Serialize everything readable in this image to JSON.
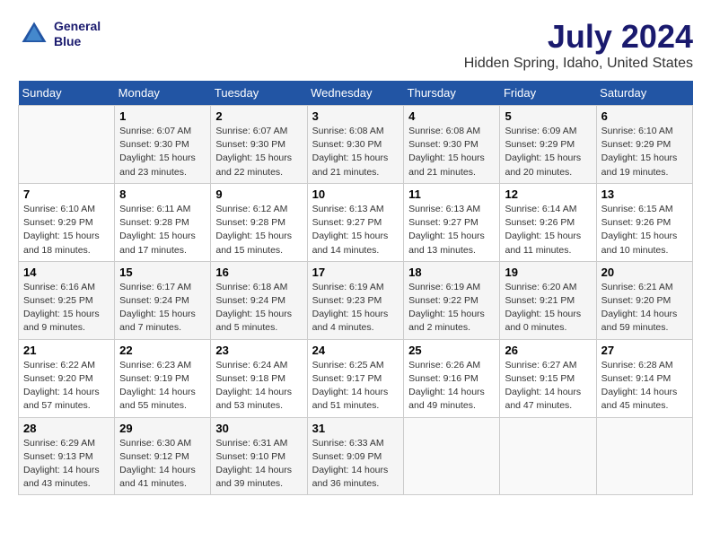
{
  "header": {
    "logo_line1": "General",
    "logo_line2": "Blue",
    "main_title": "July 2024",
    "subtitle": "Hidden Spring, Idaho, United States"
  },
  "calendar": {
    "days_of_week": [
      "Sunday",
      "Monday",
      "Tuesday",
      "Wednesday",
      "Thursday",
      "Friday",
      "Saturday"
    ],
    "weeks": [
      [
        {
          "day": "",
          "info": ""
        },
        {
          "day": "1",
          "info": "Sunrise: 6:07 AM\nSunset: 9:30 PM\nDaylight: 15 hours\nand 23 minutes."
        },
        {
          "day": "2",
          "info": "Sunrise: 6:07 AM\nSunset: 9:30 PM\nDaylight: 15 hours\nand 22 minutes."
        },
        {
          "day": "3",
          "info": "Sunrise: 6:08 AM\nSunset: 9:30 PM\nDaylight: 15 hours\nand 21 minutes."
        },
        {
          "day": "4",
          "info": "Sunrise: 6:08 AM\nSunset: 9:30 PM\nDaylight: 15 hours\nand 21 minutes."
        },
        {
          "day": "5",
          "info": "Sunrise: 6:09 AM\nSunset: 9:29 PM\nDaylight: 15 hours\nand 20 minutes."
        },
        {
          "day": "6",
          "info": "Sunrise: 6:10 AM\nSunset: 9:29 PM\nDaylight: 15 hours\nand 19 minutes."
        }
      ],
      [
        {
          "day": "7",
          "info": "Sunrise: 6:10 AM\nSunset: 9:29 PM\nDaylight: 15 hours\nand 18 minutes."
        },
        {
          "day": "8",
          "info": "Sunrise: 6:11 AM\nSunset: 9:28 PM\nDaylight: 15 hours\nand 17 minutes."
        },
        {
          "day": "9",
          "info": "Sunrise: 6:12 AM\nSunset: 9:28 PM\nDaylight: 15 hours\nand 15 minutes."
        },
        {
          "day": "10",
          "info": "Sunrise: 6:13 AM\nSunset: 9:27 PM\nDaylight: 15 hours\nand 14 minutes."
        },
        {
          "day": "11",
          "info": "Sunrise: 6:13 AM\nSunset: 9:27 PM\nDaylight: 15 hours\nand 13 minutes."
        },
        {
          "day": "12",
          "info": "Sunrise: 6:14 AM\nSunset: 9:26 PM\nDaylight: 15 hours\nand 11 minutes."
        },
        {
          "day": "13",
          "info": "Sunrise: 6:15 AM\nSunset: 9:26 PM\nDaylight: 15 hours\nand 10 minutes."
        }
      ],
      [
        {
          "day": "14",
          "info": "Sunrise: 6:16 AM\nSunset: 9:25 PM\nDaylight: 15 hours\nand 9 minutes."
        },
        {
          "day": "15",
          "info": "Sunrise: 6:17 AM\nSunset: 9:24 PM\nDaylight: 15 hours\nand 7 minutes."
        },
        {
          "day": "16",
          "info": "Sunrise: 6:18 AM\nSunset: 9:24 PM\nDaylight: 15 hours\nand 5 minutes."
        },
        {
          "day": "17",
          "info": "Sunrise: 6:19 AM\nSunset: 9:23 PM\nDaylight: 15 hours\nand 4 minutes."
        },
        {
          "day": "18",
          "info": "Sunrise: 6:19 AM\nSunset: 9:22 PM\nDaylight: 15 hours\nand 2 minutes."
        },
        {
          "day": "19",
          "info": "Sunrise: 6:20 AM\nSunset: 9:21 PM\nDaylight: 15 hours\nand 0 minutes."
        },
        {
          "day": "20",
          "info": "Sunrise: 6:21 AM\nSunset: 9:20 PM\nDaylight: 14 hours\nand 59 minutes."
        }
      ],
      [
        {
          "day": "21",
          "info": "Sunrise: 6:22 AM\nSunset: 9:20 PM\nDaylight: 14 hours\nand 57 minutes."
        },
        {
          "day": "22",
          "info": "Sunrise: 6:23 AM\nSunset: 9:19 PM\nDaylight: 14 hours\nand 55 minutes."
        },
        {
          "day": "23",
          "info": "Sunrise: 6:24 AM\nSunset: 9:18 PM\nDaylight: 14 hours\nand 53 minutes."
        },
        {
          "day": "24",
          "info": "Sunrise: 6:25 AM\nSunset: 9:17 PM\nDaylight: 14 hours\nand 51 minutes."
        },
        {
          "day": "25",
          "info": "Sunrise: 6:26 AM\nSunset: 9:16 PM\nDaylight: 14 hours\nand 49 minutes."
        },
        {
          "day": "26",
          "info": "Sunrise: 6:27 AM\nSunset: 9:15 PM\nDaylight: 14 hours\nand 47 minutes."
        },
        {
          "day": "27",
          "info": "Sunrise: 6:28 AM\nSunset: 9:14 PM\nDaylight: 14 hours\nand 45 minutes."
        }
      ],
      [
        {
          "day": "28",
          "info": "Sunrise: 6:29 AM\nSunset: 9:13 PM\nDaylight: 14 hours\nand 43 minutes."
        },
        {
          "day": "29",
          "info": "Sunrise: 6:30 AM\nSunset: 9:12 PM\nDaylight: 14 hours\nand 41 minutes."
        },
        {
          "day": "30",
          "info": "Sunrise: 6:31 AM\nSunset: 9:10 PM\nDaylight: 14 hours\nand 39 minutes."
        },
        {
          "day": "31",
          "info": "Sunrise: 6:33 AM\nSunset: 9:09 PM\nDaylight: 14 hours\nand 36 minutes."
        },
        {
          "day": "",
          "info": ""
        },
        {
          "day": "",
          "info": ""
        },
        {
          "day": "",
          "info": ""
        }
      ]
    ]
  }
}
